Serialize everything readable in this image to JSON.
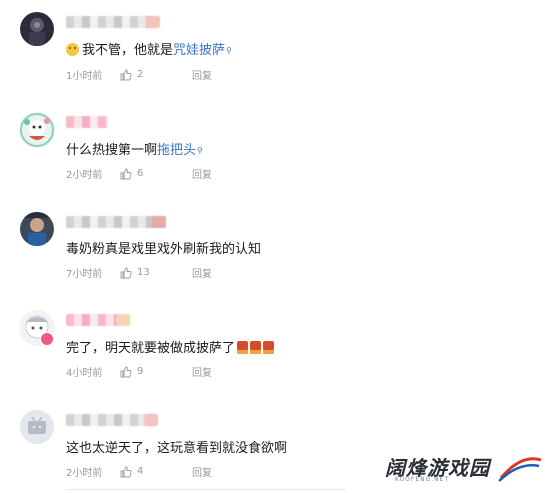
{
  "comments": [
    {
      "text_plain": "我不管，他就是",
      "link_text": "咒娃披萨",
      "time": "1小时前",
      "likes": "2",
      "reply_label": "回复"
    },
    {
      "text_plain": "什么热搜第一啊",
      "link_text": "拖把头",
      "time": "2小时前",
      "likes": "6",
      "reply_label": "回复"
    },
    {
      "text_plain": "毒奶粉真是戏里戏外刷新我的认知",
      "time": "7小时前",
      "likes": "13",
      "reply_label": "回复"
    },
    {
      "text_plain": "完了，明天就要被做成披萨了",
      "time": "4小时前",
      "likes": "9",
      "reply_label": "回复"
    },
    {
      "text_plain": "这也太逆天了，这玩意看到就没食欲啊",
      "time": "2小时前",
      "likes": "4",
      "reply_label": "回复"
    }
  ],
  "watermark": {
    "title": "阔烽游戏园",
    "subtitle": "KUOFENG.NET"
  },
  "colors": {
    "link": "#3b73c2",
    "meta": "#999999"
  },
  "icons": {
    "like": "thumbs-up-icon",
    "emoji": "smiling-face-icon",
    "fire": "fire-emoji-icon",
    "search_sup": "search-icon"
  }
}
